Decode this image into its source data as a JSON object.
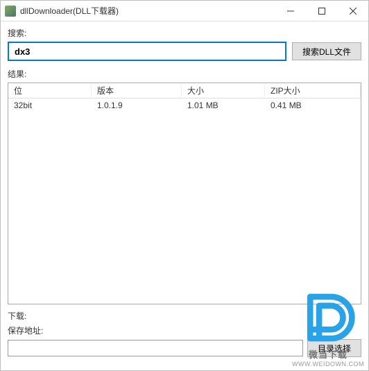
{
  "window": {
    "title": "dllDownloader(DLL下载器)"
  },
  "search": {
    "label": "搜索:",
    "value": "dx3",
    "button": "搜索DLL文件"
  },
  "results": {
    "label": "结果:",
    "columns": [
      "位",
      "版本",
      "大小",
      "ZIP大小"
    ],
    "rows": [
      {
        "bit": "32bit",
        "version": "1.0.1.9",
        "size": "1.01 MB",
        "zip": "0.41 MB"
      }
    ]
  },
  "download": {
    "label": "下载:",
    "path_label": "保存地址:",
    "path_value": "",
    "browse_button": "目录选择"
  },
  "watermark": {
    "line1": "微当下载",
    "line2": "WWW.WEIDOWN.COM"
  }
}
